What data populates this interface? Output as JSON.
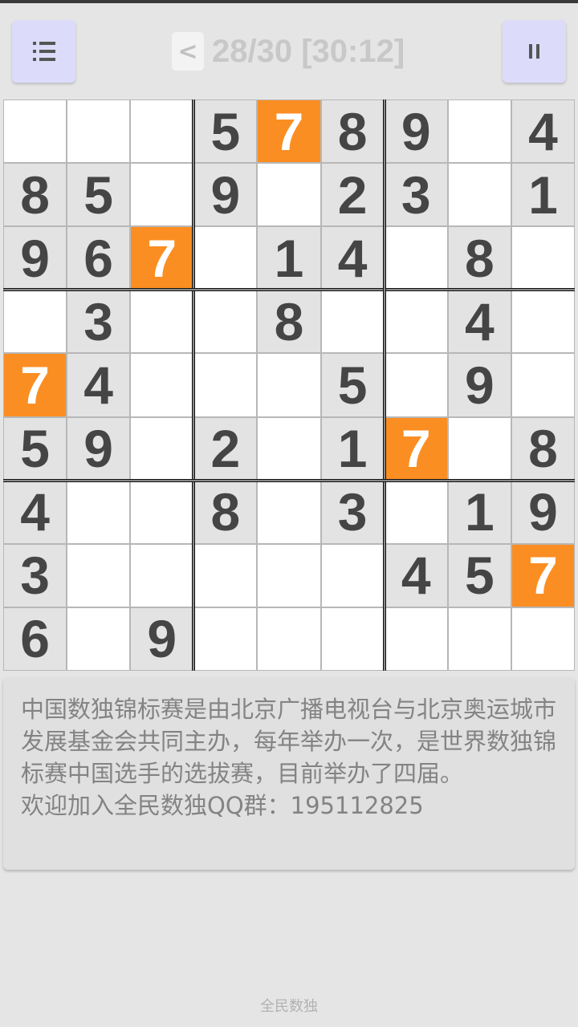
{
  "header": {
    "back_label": "<",
    "title": "28/30 [30:12]",
    "menu_icon": "menu-list-icon",
    "pause_icon": "pause-icon"
  },
  "board": {
    "rows": [
      [
        "",
        "",
        "",
        "5",
        "7",
        "8",
        "9",
        "",
        "4"
      ],
      [
        "8",
        "5",
        "",
        "9",
        "",
        "2",
        "3",
        "",
        "1"
      ],
      [
        "9",
        "6",
        "7",
        "",
        "1",
        "4",
        "",
        "8",
        ""
      ],
      [
        "",
        "3",
        "",
        "",
        "8",
        "",
        "",
        "4",
        ""
      ],
      [
        "7",
        "4",
        "",
        "",
        "",
        "5",
        "",
        "9",
        ""
      ],
      [
        "5",
        "9",
        "",
        "2",
        "",
        "1",
        "7",
        "",
        "8"
      ],
      [
        "4",
        "",
        "",
        "8",
        "",
        "3",
        "",
        "1",
        "9"
      ],
      [
        "3",
        "",
        "",
        "",
        "",
        "",
        "4",
        "5",
        "7"
      ],
      [
        "6",
        "",
        "9",
        "",
        "",
        "",
        "",
        "",
        ""
      ]
    ],
    "highlighted_value": "7",
    "colors": {
      "highlight": "#fb8e22",
      "given": "#e3e3e3",
      "empty": "#ffffff",
      "digit": "#454545"
    }
  },
  "info": {
    "paragraph": "中国数独锦标赛是由北京广播电视台与北京奥运城市发展基金会共同主办，每年举办一次，是世界数独锦标赛中国选手的选拔赛，目前举办了四届。",
    "qq_line": "欢迎加入全民数独QQ群：195112825"
  },
  "footer": {
    "app_name": "全民数独"
  }
}
